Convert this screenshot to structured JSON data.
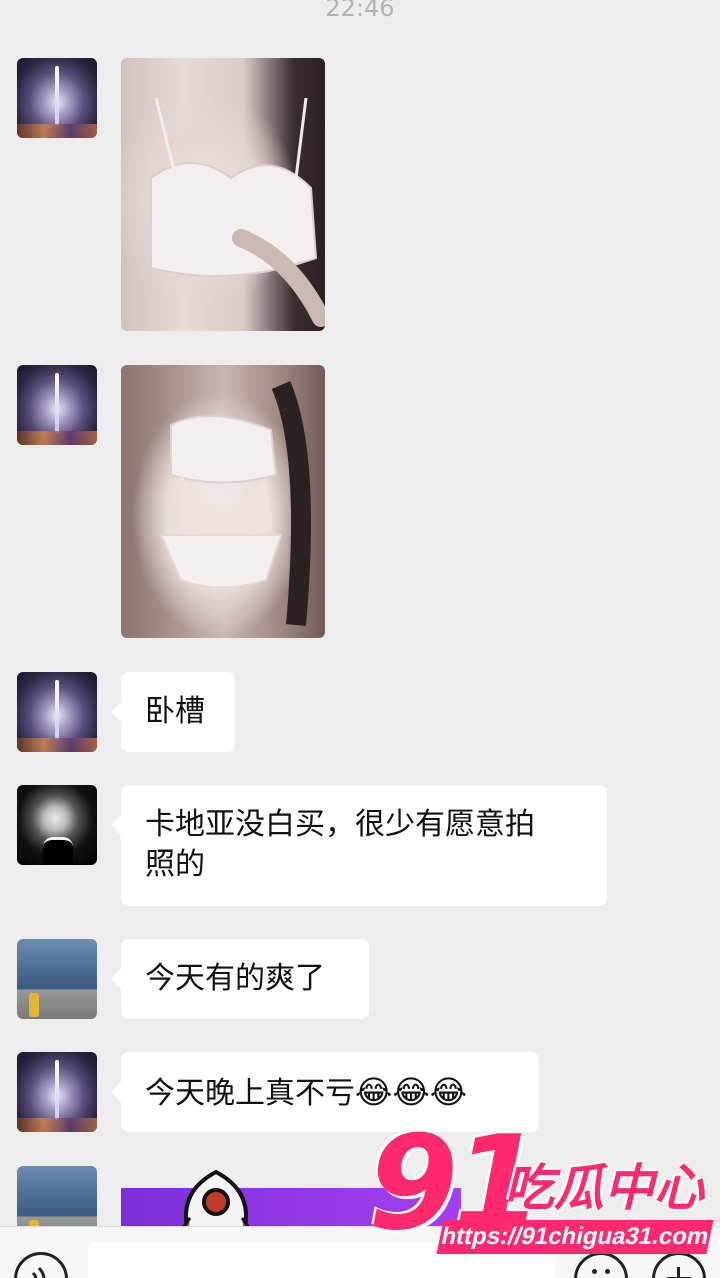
{
  "status": {
    "time": "22:46"
  },
  "messages": [
    {
      "type": "image",
      "avatar": "tower-avatar"
    },
    {
      "type": "image",
      "avatar": "tower-avatar"
    },
    {
      "type": "text",
      "avatar": "tower-avatar",
      "text": "卧槽"
    },
    {
      "type": "text",
      "avatar": "man-avatar",
      "line1": "卡地亚没白买，很少有愿意拍",
      "line2": "照的"
    },
    {
      "type": "text",
      "avatar": "car-avatar",
      "text": "今天有的爽了"
    },
    {
      "type": "text",
      "avatar": "tower-avatar",
      "text": "今天晚上真不亏",
      "emoji": "😂😂😂"
    },
    {
      "type": "card",
      "avatar": "car-avatar"
    }
  ],
  "watermark": {
    "number": "91",
    "name": "吃瓜中心",
    "url": "https://91chigua31.com"
  },
  "input_bar": {
    "icons": [
      "voice-icon",
      "emoji-icon",
      "plus-icon"
    ]
  }
}
